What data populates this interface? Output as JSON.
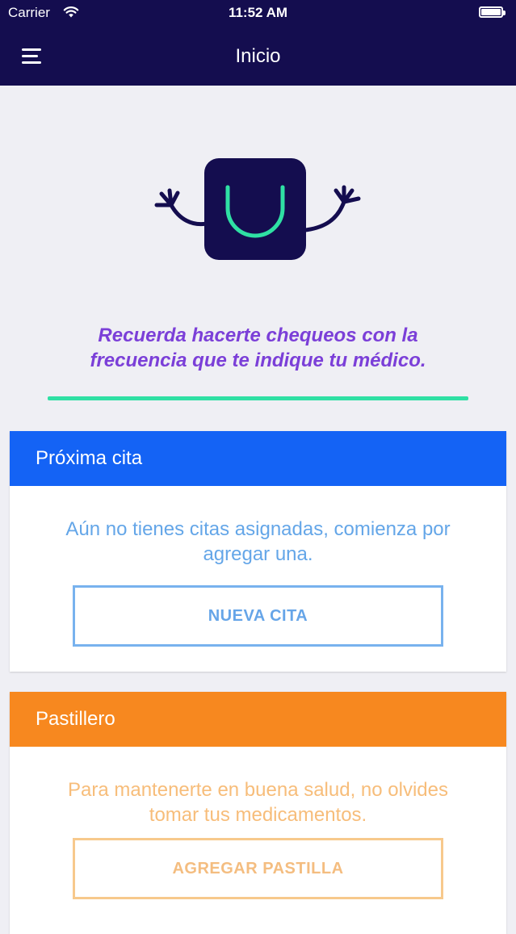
{
  "status_bar": {
    "carrier": "Carrier",
    "time": "11:52 AM",
    "wifi_icon": "wifi-icon",
    "battery_icon": "battery-icon"
  },
  "nav": {
    "title": "Inicio",
    "menu_icon": "hamburger-menu-icon"
  },
  "mascot": {
    "icon": "smiling-mascot-icon"
  },
  "reminder": {
    "line1": "Recuerda hacerte chequeos con la",
    "line2": "frecuencia que te indique tu médico."
  },
  "appointment_card": {
    "title": "Próxima cita",
    "message_line1": "Aún no tienes citas asignadas, comienza por",
    "message_line2": "agregar una.",
    "button_label": "NUEVA CITA"
  },
  "pillbox_card": {
    "title": "Pastillero",
    "message_line1": "Para mantenerte en buena salud, no olvides",
    "message_line2": "tomar tus medicamentos.",
    "button_label": "AGREGAR PASTILLA"
  },
  "colors": {
    "nav_background": "#140d4f",
    "reminder_text": "#7b3fd8",
    "divider": "#2fe0a4",
    "appointment_header": "#1463f5",
    "pillbox_header": "#f7881f",
    "page_background": "#efeff4"
  }
}
